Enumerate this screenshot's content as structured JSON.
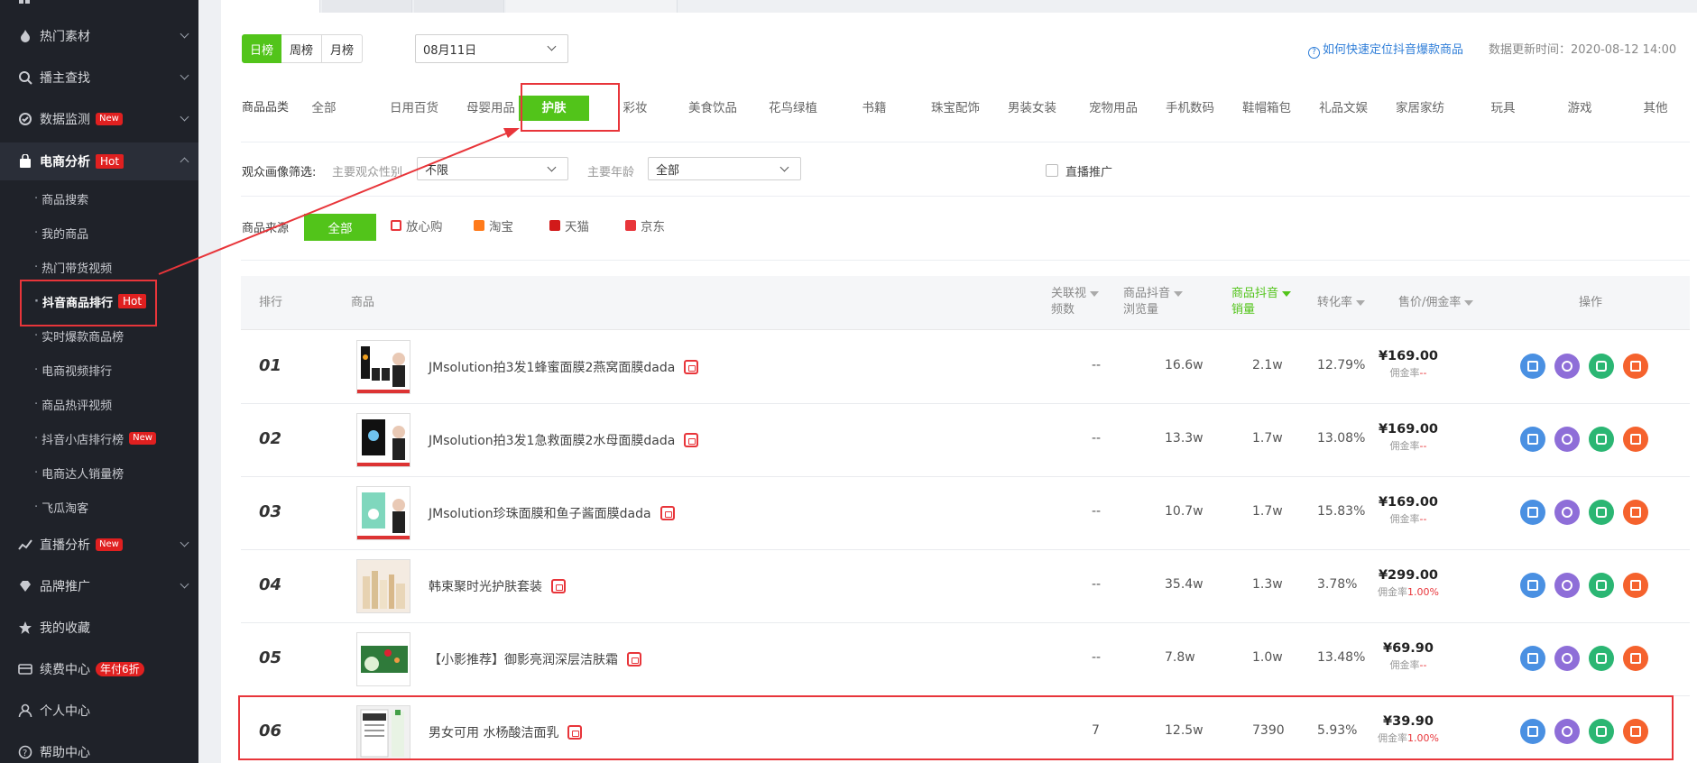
{
  "sidebar": {
    "items": [
      {
        "label": "热门素材"
      },
      {
        "label": "播主查找"
      },
      {
        "label": "数据监测",
        "badge": "New"
      },
      {
        "label": "电商分析",
        "badge": "Hot"
      }
    ],
    "sub_items": [
      {
        "label": "商品搜索"
      },
      {
        "label": "我的商品"
      },
      {
        "label": "热门带货视频"
      },
      {
        "label": "抖音商品排行",
        "badge": "Hot"
      },
      {
        "label": "实时爆款商品榜"
      },
      {
        "label": "电商视频排行"
      },
      {
        "label": "商品热评视频"
      },
      {
        "label": "抖音小店排行榜",
        "badge": "New"
      },
      {
        "label": "电商达人销量榜"
      },
      {
        "label": "飞瓜淘客"
      }
    ],
    "items_after": [
      {
        "label": "直播分析",
        "badge": "New"
      },
      {
        "label": "品牌推广"
      },
      {
        "label": "我的收藏"
      },
      {
        "label": "续费中心",
        "badge": "年付6折"
      },
      {
        "label": "个人中心"
      },
      {
        "label": "帮助中心"
      }
    ]
  },
  "filters": {
    "period_tabs": [
      "日榜",
      "周榜",
      "月榜"
    ],
    "date_value": "08月11日",
    "help_link": "如何快速定位抖音爆款商品",
    "update_time": "数据更新时间：2020-08-12 14:00",
    "category_label": "商品品类",
    "categories": [
      "全部",
      "日用百货",
      "母婴用品",
      "护肤",
      "彩妆",
      "美食饮品",
      "花鸟绿植",
      "书籍",
      "珠宝配饰",
      "男装女装",
      "宠物用品",
      "手机数码",
      "鞋帽箱包",
      "礼品文娱",
      "家居家纺",
      "玩具",
      "游戏",
      "其他"
    ],
    "audience_label": "观众画像筛选:",
    "gender_label": "主要观众性别",
    "gender_value": "不限",
    "age_label": "主要年龄",
    "age_value": "全部",
    "live_promo_label": "直播推广",
    "source_label": "商品来源",
    "sources": [
      "全部",
      "放心购",
      "淘宝",
      "天猫",
      "京东"
    ]
  },
  "table": {
    "headers": {
      "rank": "排行",
      "product": "商品",
      "videos": [
        "关联视",
        "频数"
      ],
      "views": [
        "商品抖音",
        "浏览量"
      ],
      "sales": [
        "商品抖音",
        "销量"
      ],
      "conversion": "转化率",
      "price": "售价/佣金率",
      "actions": "操作"
    },
    "commission_prefix": "佣金率",
    "rows": [
      {
        "rank": "01",
        "name": "JMsolution拍3发1蜂蜜面膜2燕窝面膜dada",
        "videos": "--",
        "views": "16.6w",
        "sales": "2.1w",
        "conversion": "12.79%",
        "price": "¥169.00",
        "commission": "--"
      },
      {
        "rank": "02",
        "name": "JMsolution拍3发1急救面膜2水母面膜dada",
        "videos": "--",
        "views": "13.3w",
        "sales": "1.7w",
        "conversion": "13.08%",
        "price": "¥169.00",
        "commission": "--"
      },
      {
        "rank": "03",
        "name": "JMsolution珍珠面膜和鱼子酱面膜dada",
        "videos": "--",
        "views": "10.7w",
        "sales": "1.7w",
        "conversion": "15.83%",
        "price": "¥169.00",
        "commission": "--"
      },
      {
        "rank": "04",
        "name": "韩束聚时光护肤套装",
        "videos": "--",
        "views": "35.4w",
        "sales": "1.3w",
        "conversion": "3.78%",
        "price": "¥299.00",
        "commission": "1.00%"
      },
      {
        "rank": "05",
        "name": "【小影推荐】御影亮润深层洁肤霜",
        "videos": "--",
        "views": "7.8w",
        "sales": "1.0w",
        "conversion": "13.48%",
        "price": "¥69.90",
        "commission": "--"
      },
      {
        "rank": "06",
        "name": "男女可用 水杨酸洁面乳",
        "videos": "7",
        "views": "12.5w",
        "sales": "7390",
        "conversion": "5.93%",
        "price": "¥39.90",
        "commission": "1.00%"
      }
    ]
  },
  "colors": {
    "accent": "#52c41a",
    "highlight": "#e8353a",
    "sidebar": "#1f2229",
    "link": "#2f7ed8"
  }
}
